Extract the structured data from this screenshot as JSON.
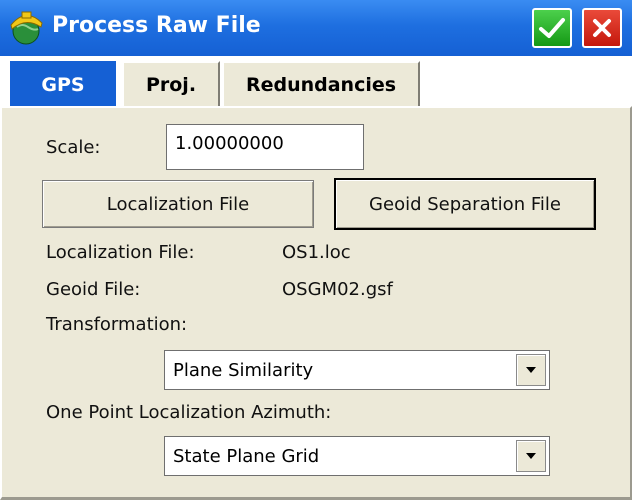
{
  "window": {
    "title": "Process Raw File"
  },
  "tabs": [
    {
      "label": "GPS",
      "active": true
    },
    {
      "label": "Proj.",
      "active": false
    },
    {
      "label": "Redundancies",
      "active": false
    }
  ],
  "form": {
    "scale_label": "Scale:",
    "scale_value": "1.00000000",
    "localization_button": "Localization File",
    "geoid_button": "Geoid Separation File",
    "localization_file_label": "Localization File:",
    "localization_file_value": "OS1.loc",
    "geoid_file_label": "Geoid File:",
    "geoid_file_value": "OSGM02.gsf",
    "transformation_label": "Transformation:",
    "transformation_value": "Plane Similarity",
    "azimuth_label": "One Point Localization Azimuth:",
    "azimuth_value": "State Plane Grid"
  },
  "icons": {
    "app": "helmet-globe-icon",
    "ok": "checkmark-icon",
    "close": "close-icon",
    "dropdown": "dropdown-arrow-icon"
  },
  "colors": {
    "titlebar": "#1e6fe0",
    "active_tab": "#1560d4",
    "panel": "#ece9d8",
    "ok_button": "#2fbf2f",
    "close_button": "#d9291c"
  }
}
